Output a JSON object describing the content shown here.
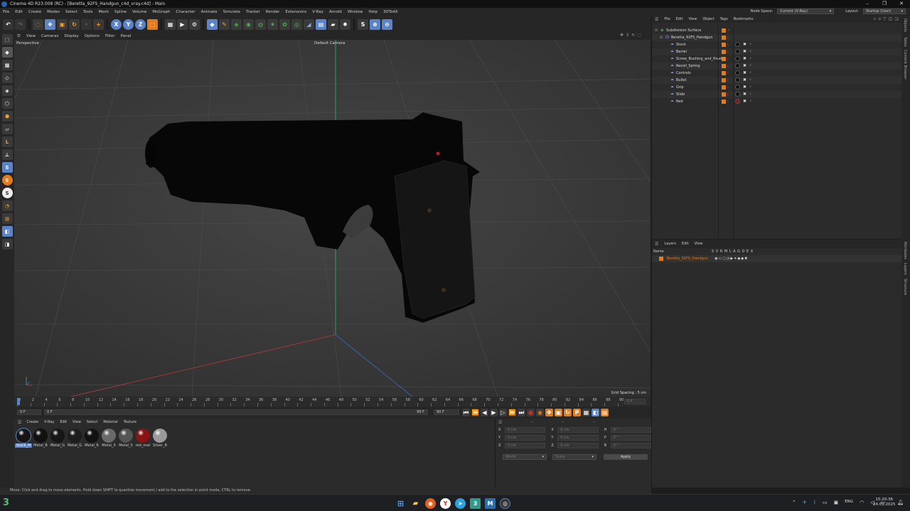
{
  "titlebar": {
    "title": "Cinema 4D R23.008 (RC) - [Beretta_92FS_Handgun_c4d_vray.c4d] - Main"
  },
  "menubar": {
    "items": [
      "File",
      "Edit",
      "Create",
      "Modes",
      "Select",
      "Tools",
      "Mesh",
      "Spline",
      "Volume",
      "MoGraph",
      "Character",
      "Animate",
      "Simulate",
      "Tracker",
      "Render",
      "Extensions",
      "V-Ray",
      "Arnold",
      "Window",
      "Help",
      "3DToAll"
    ],
    "node_space_label": "Node Space:",
    "node_space_value": "Current (V-Ray)",
    "layout_label": "Layout:",
    "layout_value": "Startup (User)"
  },
  "viewport": {
    "menu": [
      "View",
      "Cameras",
      "Display",
      "Options",
      "Filter",
      "Panel"
    ],
    "view_name": "Perspective",
    "camera": "Default Camera",
    "grid_spacing": "Grid Spacing : 5 cm"
  },
  "timeline": {
    "ticks": [
      "0",
      "2",
      "4",
      "6",
      "8",
      "10",
      "12",
      "14",
      "16",
      "18",
      "20",
      "22",
      "24",
      "26",
      "28",
      "30",
      "32",
      "34",
      "36",
      "38",
      "40",
      "42",
      "44",
      "46",
      "48",
      "50",
      "52",
      "54",
      "56",
      "58",
      "60",
      "62",
      "64",
      "66",
      "68",
      "70",
      "72",
      "74",
      "76",
      "78",
      "80",
      "82",
      "84",
      "86",
      "88",
      "90"
    ],
    "current_frame": "0 F",
    "start": "0 F",
    "preview_start": "0 F",
    "preview_end": "90 F",
    "end": "90 F"
  },
  "material_manager": {
    "menu": [
      "Create",
      "V-Ray",
      "Edit",
      "View",
      "Select",
      "Material",
      "Texture"
    ],
    "materials": [
      {
        "name": "Stock_M",
        "color": "#151515"
      },
      {
        "name": "Metal_B",
        "color": "#111111"
      },
      {
        "name": "Metal_G",
        "color": "#161616"
      },
      {
        "name": "Metal_G",
        "color": "#1d1d1d"
      },
      {
        "name": "Metal_R",
        "color": "#121212"
      },
      {
        "name": "Metal_S",
        "color": "#6a6a6a"
      },
      {
        "name": "Metal_S",
        "color": "#555555"
      },
      {
        "name": "red_mat",
        "color": "#8a1414"
      },
      {
        "name": "Silver_B",
        "color": "#9a9a9a"
      }
    ]
  },
  "coords": {
    "header": [
      "--",
      "--",
      "--"
    ],
    "rows": [
      {
        "a": "X",
        "av": "0 cm",
        "b": "X",
        "bv": "0 cm",
        "c": "H",
        "cv": "0 °"
      },
      {
        "a": "Y",
        "av": "0 cm",
        "b": "Y",
        "bv": "0 cm",
        "c": "P",
        "cv": "0 °"
      },
      {
        "a": "Z",
        "av": "0 cm",
        "b": "Z",
        "bv": "0 cm",
        "c": "B",
        "cv": "0 °"
      }
    ],
    "world": "World",
    "scale": "Scale",
    "apply": "Apply"
  },
  "object_manager": {
    "menu": [
      "File",
      "Edit",
      "View",
      "Object",
      "Tags",
      "Bookmarks"
    ],
    "objects": [
      {
        "name": "Subdivision Surface",
        "indent": 0
      },
      {
        "name": "Beretta_92FS_Handgun",
        "indent": 1
      },
      {
        "name": "Stock",
        "indent": 2
      },
      {
        "name": "Barrel",
        "indent": 2
      },
      {
        "name": "Screw_Bushing_and_Rivets",
        "indent": 2
      },
      {
        "name": "Recoil_Spring",
        "indent": 2
      },
      {
        "name": "Controls",
        "indent": 2
      },
      {
        "name": "Bullet",
        "indent": 2
      },
      {
        "name": "Grip",
        "indent": 2
      },
      {
        "name": "Slide",
        "indent": 2
      },
      {
        "name": "Red",
        "indent": 2
      }
    ]
  },
  "layer_manager": {
    "menu": [
      "Layers",
      "Edit",
      "View"
    ],
    "name_header": "Name",
    "columns": "S V R M L A G D E X",
    "layers": [
      "Beretta_92FS_Handgun"
    ]
  },
  "side_tabs": [
    "Objects",
    "Takes",
    "Content Browser",
    "Attributes",
    "Layers",
    "Structure"
  ],
  "statusbar": {
    "text": "Move: Click and drag to move elements. Hold down SHIFT to quantize movement / add to the selection in point mode, CTRL to remove."
  },
  "taskbar": {
    "lang": "ENG",
    "time": "15:20:36",
    "date": "24.01.2025"
  },
  "colors": {
    "accent": "#e07b1f",
    "selection": "#5b83c9",
    "vray_orange": "#f0a030"
  }
}
